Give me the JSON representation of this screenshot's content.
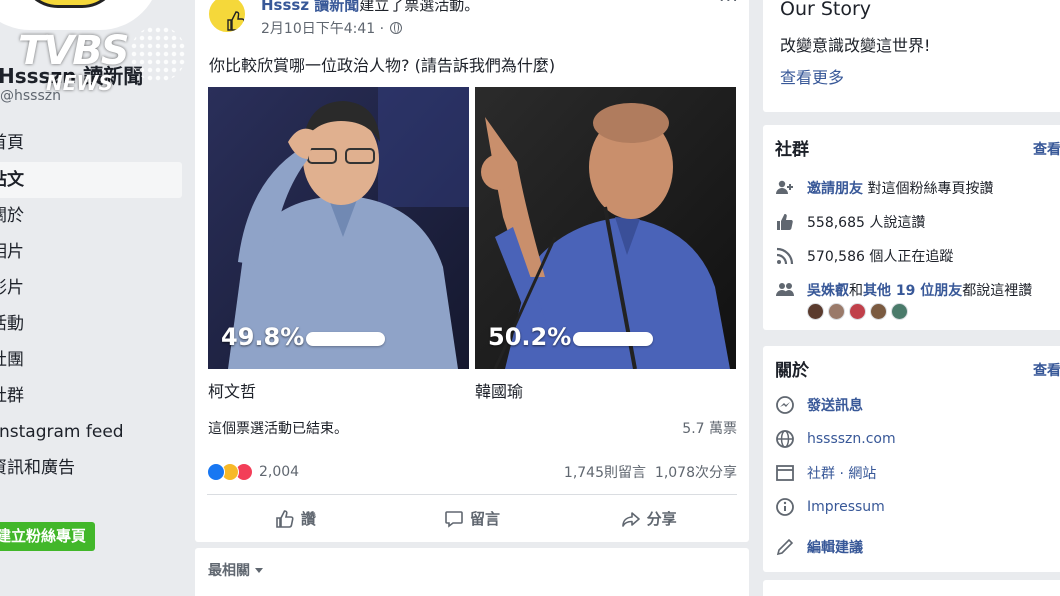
{
  "watermark": {
    "brand": "TVBS",
    "sub": "NEWS"
  },
  "page": {
    "name": "Hssszn 讀新聞",
    "handle": "@hssszn"
  },
  "nav": {
    "items": [
      {
        "label": "首頁"
      },
      {
        "label": "貼文"
      },
      {
        "label": "關於"
      },
      {
        "label": "相片"
      },
      {
        "label": "影片"
      },
      {
        "label": "活動"
      },
      {
        "label": "社團"
      },
      {
        "label": "社群"
      },
      {
        "label": "Instagram feed"
      },
      {
        "label": "資訊和廣告"
      }
    ],
    "create_page_label": "建立粉絲專頁"
  },
  "post": {
    "author": "Hsssz 讀新聞",
    "action": "建立了票選活動。",
    "time": "2月10日下午4:41 ·",
    "more": "···",
    "question": "你比較欣賞哪一位政治人物? (請告訴我們為什麼)",
    "poll": {
      "options": [
        {
          "name": "柯文哲",
          "percent_label": "49.8%",
          "share": 0.498
        },
        {
          "name": "韓國瑜",
          "percent_label": "50.2%",
          "share": 0.502
        }
      ],
      "ended_text": "這個票選活動已結束。",
      "votes": "5.7 萬票"
    },
    "reactions_count": "2,004",
    "comments": "1,745則留言",
    "shares": "1,078次分享",
    "actions": {
      "like": "讚",
      "comment": "留言",
      "share": "分享"
    },
    "sort_label": "最相關"
  },
  "sidebar_right": {
    "story": {
      "title": "Our Story",
      "text": "改變意識改變這世界!",
      "more": "查看更多"
    },
    "community": {
      "title": "社群",
      "see_all": "查看",
      "invite_link": "邀請朋友",
      "invite_rest": "對這個粉絲專頁按讚",
      "likes": "558,685 人說這讚",
      "followers": "570,586 個人正在追蹤",
      "friends_name": "吳姝叡",
      "friends_and": "和",
      "friends_others": "其他 19 位朋友",
      "friends_rest": "都說這裡讚"
    },
    "about": {
      "title": "關於",
      "see_all": "查看",
      "message": "發送訊息",
      "website": "hsssszn.com",
      "category": "社群 · 網站",
      "impressum": "Impressum",
      "suggest": "編輯建議"
    }
  },
  "colors": {
    "link": "#385898",
    "facebook_bg": "#e9ebee",
    "green_button": "#42b72a",
    "like_blue": "#1877f2",
    "love_red": "#f33e58",
    "haha_yellow": "#f7b928"
  }
}
